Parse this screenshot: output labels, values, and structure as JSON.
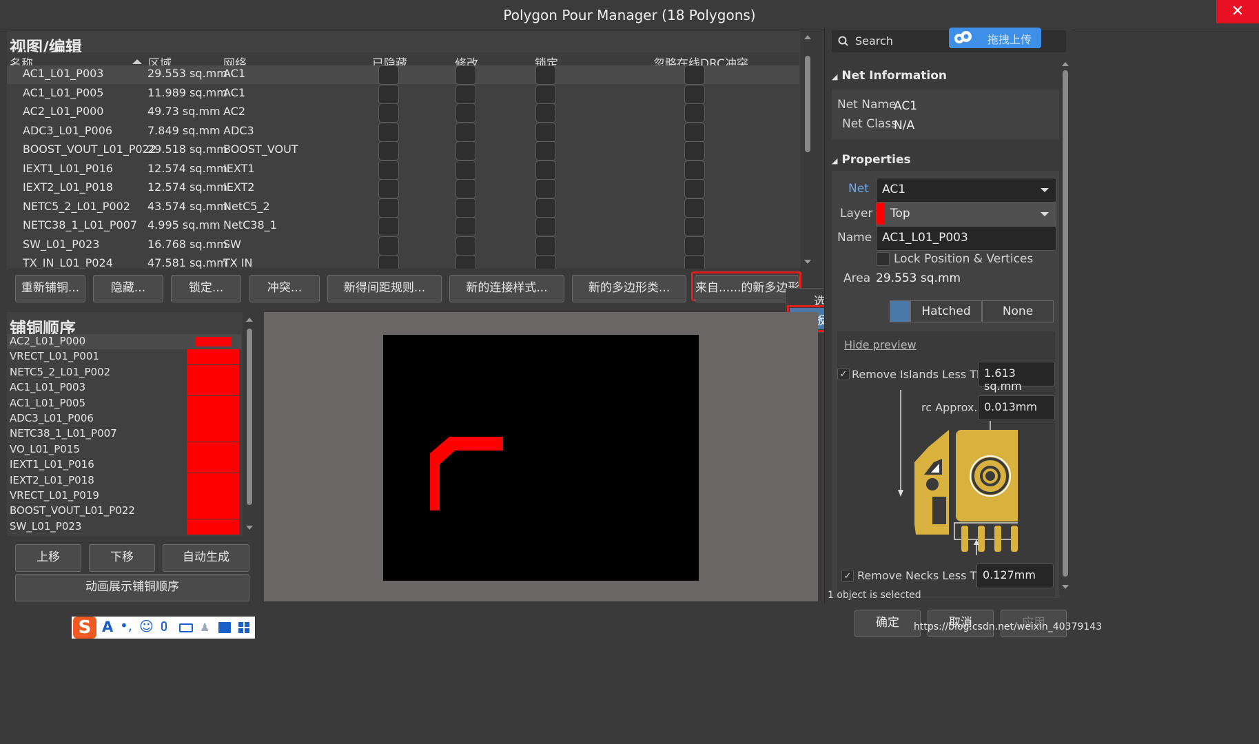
{
  "window": {
    "title": "Polygon Pour Manager (18 Polygons)",
    "close": "✕"
  },
  "top_panel": {
    "header": "视图/编辑",
    "columns": [
      "名称",
      "区域",
      "网络",
      "已隐藏",
      "修改",
      "锁定",
      "忽略在线DRC冲突"
    ],
    "rows": [
      {
        "name": "AC1_L01_P003",
        "area": "29.553 sq.mm",
        "net": "AC1"
      },
      {
        "name": "AC1_L01_P005",
        "area": "11.989 sq.mm",
        "net": "AC1"
      },
      {
        "name": "AC2_L01_P000",
        "area": "49.73 sq.mm",
        "net": "AC2"
      },
      {
        "name": "ADC3_L01_P006",
        "area": "7.849 sq.mm",
        "net": "ADC3"
      },
      {
        "name": "BOOST_VOUT_L01_P022",
        "area": "29.518 sq.mm",
        "net": "BOOST_VOUT"
      },
      {
        "name": "IEXT1_L01_P016",
        "area": "12.574 sq.mm",
        "net": "IEXT1"
      },
      {
        "name": "IEXT2_L01_P018",
        "area": "12.574 sq.mm",
        "net": "IEXT2"
      },
      {
        "name": "NETC5_2_L01_P002",
        "area": "43.574 sq.mm",
        "net": "NetC5_2"
      },
      {
        "name": "NETC38_1_L01_P007",
        "area": "4.995 sq.mm",
        "net": "NetC38_1"
      },
      {
        "name": "SW_L01_P023",
        "area": "16.768 sq.mm",
        "net": "SW"
      },
      {
        "name": "TX_IN_L01_P024",
        "area": "47.581 sq.mm",
        "net": "TX IN"
      }
    ],
    "buttons": [
      "重新铺铜...",
      "隐藏...",
      "锁定...",
      "冲突...",
      "新得间距规则...",
      "新的连接样式...",
      "新的多边形类...",
      "来自......的新多边形"
    ]
  },
  "dropdown_menu": {
    "items": [
      "选择的铺铜",
      "板外形"
    ]
  },
  "order_panel": {
    "header": "铺铜顺序",
    "items": [
      "AC2_L01_P000",
      "VRECT_L01_P001",
      "NETC5_2_L01_P002",
      "AC1_L01_P003",
      "AC1_L01_P005",
      "ADC3_L01_P006",
      "NETC38_1_L01_P007",
      "VO_L01_P015",
      "IEXT1_L01_P016",
      "IEXT2_L01_P018",
      "VRECT_L01_P019",
      "BOOST_VOUT_L01_P022",
      "SW_L01_P023"
    ],
    "buttons": {
      "up": "上移",
      "down": "下移",
      "auto": "自动生成",
      "animate": "动画展示铺铜顺序"
    }
  },
  "right_panel": {
    "search_placeholder": "Search",
    "upload_badge": "拖拽上传",
    "net_info": {
      "header": "Net Information",
      "net_name_label": "Net Name",
      "net_name": "AC1",
      "net_class_label": "Net Class",
      "net_class": "N/A"
    },
    "properties": {
      "header": "Properties",
      "net_label": "Net",
      "net": "AC1",
      "layer_label": "Layer",
      "layer": "Top",
      "name_label": "Name",
      "name": "AC1_L01_P003",
      "lock_label": "Lock Position & Vertices",
      "area_label": "Area",
      "area": "29.553 sq.mm",
      "fill_modes": [
        "Hatched",
        "None"
      ],
      "hide_preview": "Hide preview",
      "remove_islands_label": "Remove Islands Less Than",
      "remove_islands": "1.613 sq.mm",
      "arc_label": "rc Approx.",
      "arc": "0.013mm",
      "remove_necks_label": "Remove Necks Less Than",
      "remove_necks": "0.127mm"
    },
    "status": "1 object is selected"
  },
  "footer": {
    "ok": "确定",
    "cancel": "取消",
    "apply": "应用",
    "watermark": "https://blog.csdn.net/weixin_40379143"
  },
  "colors": {
    "accent": "#ff0000",
    "highlight_border": "#e0201c",
    "menu_selected": "#4a78a8",
    "pcb_copper": "#d9b13e"
  }
}
